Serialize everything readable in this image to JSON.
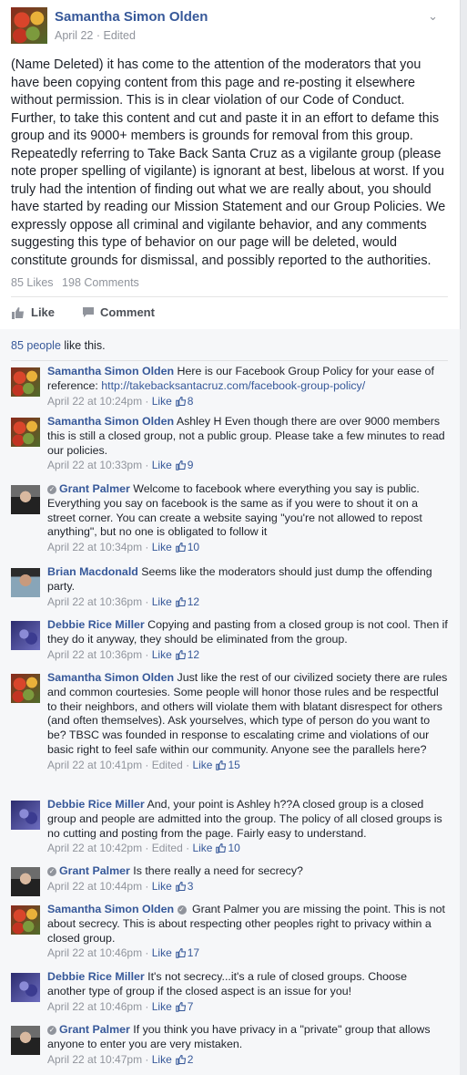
{
  "post": {
    "author": "Samantha Simon Olden",
    "date": "April 22 · Edited",
    "text": "(Name Deleted) it has come to the attention of the moderators that you have been copying content from this page and re-posting it elsewhere without permission. This is in clear violation of our Code of Conduct. Further, to take this content and cut and paste it in an effort to defame this group and its 9000+ members is grounds for removal from this group. Repeatedly referring to Take Back Santa Cruz as a vigilante group (please note proper spelling of vigilante) is ignorant at best, libelous at worst. If you truly had the intention of finding out what we are really about, you should have started by reading our Mission Statement and our Group Policies. We expressly oppose all criminal and vigilante behavior, and any comments suggesting this type of behavior on our page will be deleted, would constitute grounds for dismissal, and possibly reported to the authorities.",
    "likes": "85 Likes",
    "comments": "198 Comments",
    "like_label": "Like",
    "comment_label": "Comment"
  },
  "likes_summary": {
    "link": "85 people",
    "rest": " like this."
  },
  "comments": [
    {
      "name": "Samantha Simon Olden",
      "verified": false,
      "text": " Here is our Facebook Group Policy for your ease of reference: ",
      "link": "http://takebacksantacruz.com/facebook-group-policy/",
      "time": "April 22 at 10:24pm",
      "edited": "",
      "like": "Like",
      "count": "8",
      "avatar": "tomato"
    },
    {
      "name": "Samantha Simon Olden",
      "verified": false,
      "text": " Ashley H Even though there are over 9000 members this is still a closed group, not a public group. Please take a few minutes to read our policies.",
      "link": "",
      "time": "April 22 at 10:33pm",
      "edited": "",
      "like": "Like",
      "count": "9",
      "avatar": "tomato"
    },
    {
      "name": "Grant Palmer",
      "verified": true,
      "text": " Welcome to facebook where everything you say is public. Everything you say on facebook is the same as if you were to shout it on a street corner. You can create a website saying \"you're not allowed to repost anything\", but no one is obligated to follow it",
      "link": "",
      "time": "April 22 at 10:34pm",
      "edited": "",
      "like": "Like",
      "count": "10",
      "avatar": "grant"
    },
    {
      "name": "Brian Macdonald",
      "verified": false,
      "text": " Seems like the moderators should just dump the offending party.",
      "link": "",
      "time": "April 22 at 10:36pm",
      "edited": "",
      "like": "Like",
      "count": "12",
      "avatar": "brian"
    },
    {
      "name": "Debbie Rice Miller",
      "verified": false,
      "text": " Copying and pasting from a closed group is not cool. Then if they do it anyway, they should be eliminated from the group.",
      "link": "",
      "time": "April 22 at 10:36pm",
      "edited": "",
      "like": "Like",
      "count": "12",
      "avatar": "debbie"
    },
    {
      "name": "Samantha Simon Olden",
      "verified": false,
      "text": " Just like the rest of our civilized society there are rules and common courtesies. Some people will honor those rules and be respectful to their neighbors, and others will violate them with blatant disrespect for others (and often themselves). Ask yourselves, which type of person do you want to be? TBSC was founded in response to escalating crime and violations of our basic right to feel safe within our community. Anyone see the parallels here?",
      "link": "",
      "time": "April 22 at 10:41pm",
      "edited": "Edited",
      "like": "Like",
      "count": "15",
      "avatar": "tomato"
    },
    {
      "name": "Debbie Rice Miller",
      "verified": false,
      "text": " And, your point is Ashley h??A closed group is a closed group and people are admitted into the group. The policy of all closed groups is no cutting and posting from the page. Fairly easy to understand.",
      "link": "",
      "time": "April 22 at 10:42pm",
      "edited": "Edited",
      "like": "Like",
      "count": "10",
      "avatar": "debbie"
    },
    {
      "name": "Grant Palmer",
      "verified": true,
      "text": " Is there really a need for secrecy?",
      "link": "",
      "time": "April 22 at 10:44pm",
      "edited": "",
      "like": "Like",
      "count": "3",
      "avatar": "grant"
    },
    {
      "name": "Samantha Simon Olden",
      "verified": false,
      "text": " Grant Palmer you are missing the point. This is not about secrecy. This is about respecting other peoples right to privacy within a closed group.",
      "mention_verified": true,
      "link": "",
      "time": "April 22 at 10:46pm",
      "edited": "",
      "like": "Like",
      "count": "17",
      "avatar": "tomato"
    },
    {
      "name": "Debbie Rice Miller",
      "verified": false,
      "text": " It's not secrecy...it's a rule of closed groups. Choose another type of group if the closed aspect is an issue for you!",
      "link": "",
      "time": "April 22 at 10:46pm",
      "edited": "",
      "like": "Like",
      "count": "7",
      "avatar": "debbie"
    },
    {
      "name": "Grant Palmer",
      "verified": true,
      "text": " If you think you have privacy in a \"private\" group that allows anyone to enter you are very mistaken.",
      "link": "",
      "time": "April 22 at 10:47pm",
      "edited": "",
      "like": "Like",
      "count": "2",
      "avatar": "grant"
    }
  ]
}
